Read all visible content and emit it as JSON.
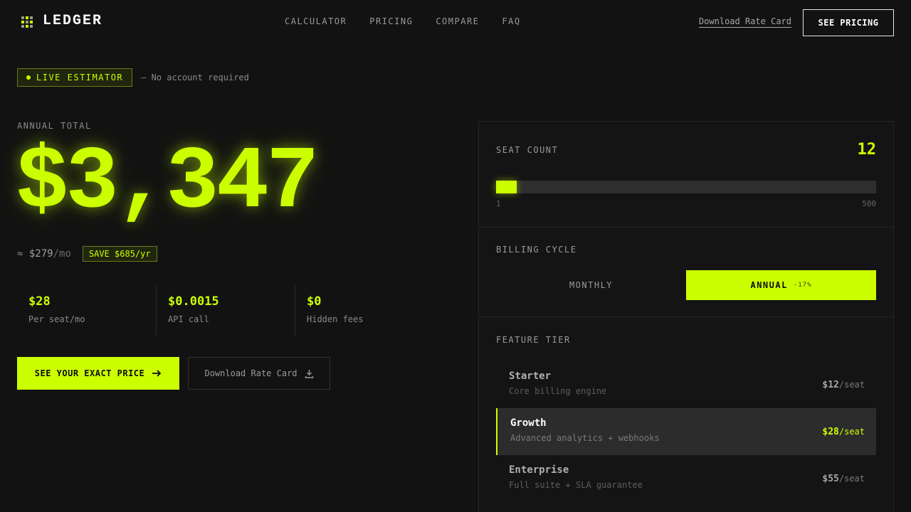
{
  "header": {
    "brand": "LEDGER",
    "nav": [
      "CALCULATOR",
      "PRICING",
      "COMPARE",
      "FAQ"
    ],
    "download_link": "Download Rate Card",
    "cta": "SEE PRICING"
  },
  "hero": {
    "live_badge": "LIVE ESTIMATOR",
    "live_note": "— No account required",
    "annual_label": "ANNUAL TOTAL",
    "annual_total": "$3,347",
    "monthly_prefix": "≈",
    "monthly_value": "$279",
    "monthly_unit": "/mo",
    "save_badge": "SAVE $685/yr",
    "stats": [
      {
        "value": "$28",
        "label": "Per seat/mo"
      },
      {
        "value": "$0.0015",
        "label": "API call"
      },
      {
        "value": "$0",
        "label": "Hidden fees"
      }
    ],
    "primary_cta": "SEE YOUR EXACT PRICE",
    "secondary_cta": "Download Rate Card"
  },
  "panel": {
    "seats": {
      "title": "SEAT COUNT",
      "value": "12",
      "min": "1",
      "max": "500",
      "fraction": 0.055
    },
    "billing": {
      "title": "BILLING CYCLE",
      "options": [
        {
          "label": "MONTHLY",
          "discount": ""
        },
        {
          "label": "ANNUAL",
          "discount": "-17%"
        }
      ],
      "selected": "ANNUAL"
    },
    "tier": {
      "title": "FEATURE TIER",
      "items": [
        {
          "name": "Starter",
          "desc": "Core billing engine",
          "price": "$12",
          "unit": "/seat"
        },
        {
          "name": "Growth",
          "desc": "Advanced analytics + webhooks",
          "price": "$28",
          "unit": "/seat"
        },
        {
          "name": "Enterprise",
          "desc": "Full suite + SLA guarantee",
          "price": "$55",
          "unit": "/seat"
        }
      ],
      "selected": "Growth"
    }
  },
  "icons": {
    "brand": "grid-logo-icon",
    "primary_cta": "arrow-right-icon",
    "secondary_cta": "download-icon"
  },
  "colors": {
    "accent": "#cbff00",
    "background": "#121212"
  }
}
